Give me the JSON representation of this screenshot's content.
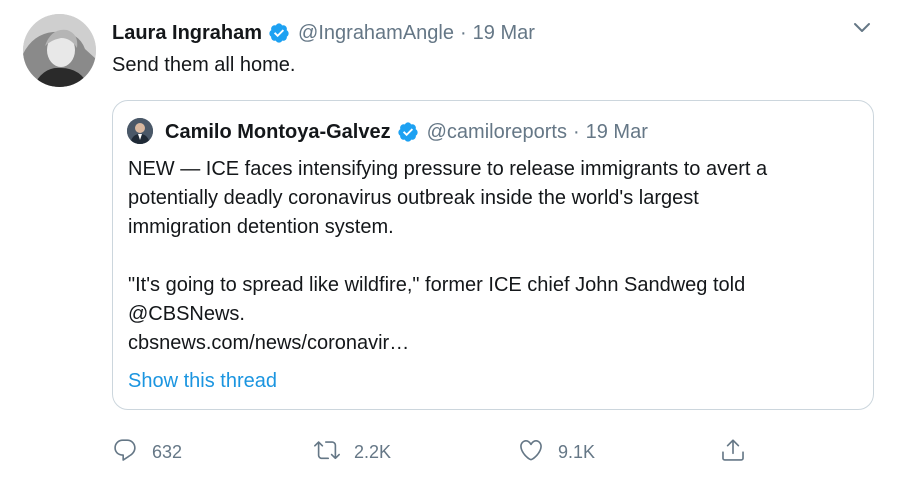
{
  "tweet": {
    "author_name": "Laura Ingraham",
    "handle": "@IngrahamAngle",
    "separator": "·",
    "date": "19 Mar",
    "text": "Send them all home."
  },
  "quoted": {
    "author_name": "Camilo Montoya-Galvez",
    "handle": "@camiloreports",
    "separator": "·",
    "date": "19 Mar",
    "lines": [
      "NEW — ICE faces intensifying pressure to release immigrants to avert a",
      "potentially deadly coronavirus outbreak inside the world's largest",
      "immigration detention system.",
      "\"It's going to spread like wildfire,\" former ICE chief John Sandweg told",
      "@CBSNews.",
      "cbsnews.com/news/coronavir…"
    ],
    "show_thread": "Show this thread"
  },
  "actions": {
    "reply_count": "632",
    "retweet_count": "2.2K",
    "like_count": "9.1K"
  },
  "icons": {
    "verified": "verified-badge-icon",
    "caret": "chevron-down-icon",
    "reply": "reply-icon",
    "retweet": "retweet-icon",
    "like": "heart-icon",
    "share": "share-icon"
  },
  "colors": {
    "verified": "#1da1f2",
    "link": "#1b95e0",
    "secondary_text": "#657786",
    "border": "#ccd6dd"
  }
}
